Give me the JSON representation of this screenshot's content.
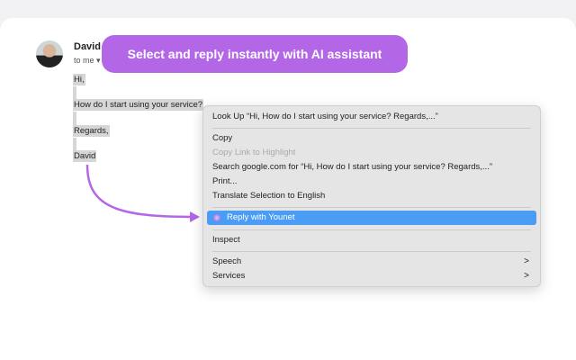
{
  "email": {
    "sender": "David",
    "recipient": "to me",
    "body": [
      "Hi,",
      "How do I start using your service?",
      "Regards,",
      "David"
    ]
  },
  "banner": {
    "text": "Select and reply instantly with AI assistant",
    "color": "#b366e6"
  },
  "context_menu": {
    "look_up": "Look Up “Hi,  How do I start using your service?  Regards,...”",
    "copy": "Copy",
    "copy_link": "Copy Link to Highlight",
    "search": "Search google.com for “Hi,  How do I start using your service?  Regards,...”",
    "print": "Print...",
    "translate": "Translate Selection to English",
    "reply": "Reply with Younet",
    "inspect": "Inspect",
    "speech": "Speech",
    "services": "Services",
    "submenu_glyph": ">"
  }
}
